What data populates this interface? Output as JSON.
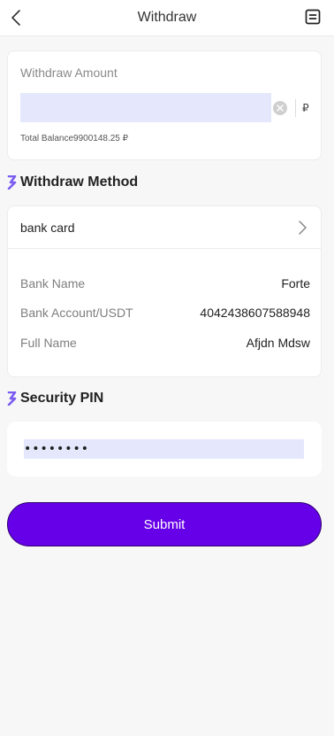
{
  "header": {
    "title": "Withdraw"
  },
  "amount": {
    "label": "Withdraw Amount",
    "value": "",
    "currency": "₽",
    "balance_text": "Total Balance9900148.25 ₽"
  },
  "method_section": {
    "title": "Withdraw Method",
    "selected_method": "bank card",
    "details": [
      {
        "label": "Bank Name",
        "value": "Forte"
      },
      {
        "label": "Bank Account/USDT",
        "value": "4042438607588948"
      },
      {
        "label": "Full Name",
        "value": "Afjdn Mdsw"
      }
    ]
  },
  "pin_section": {
    "title": "Security PIN",
    "value": "••••••••"
  },
  "submit_label": "Submit",
  "colors": {
    "accent": "#6600e8",
    "input_fill": "#e5e8fc"
  }
}
